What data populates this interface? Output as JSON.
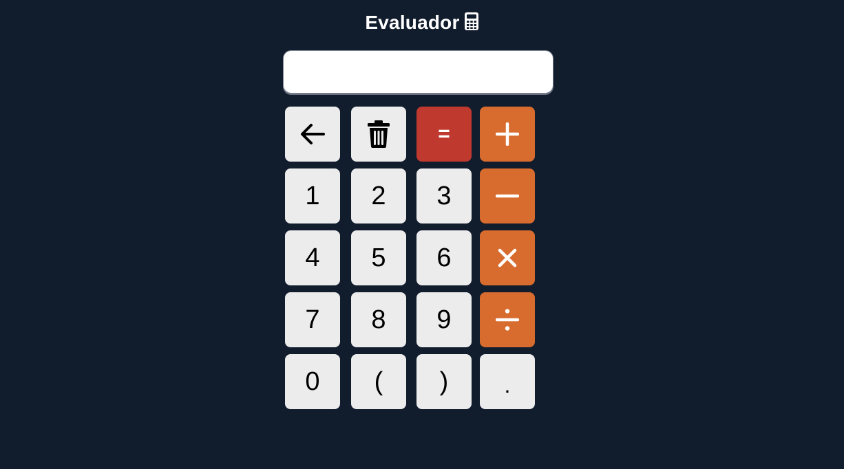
{
  "title": "Evaluador",
  "display": {
    "value": ""
  },
  "keys": {
    "backspace": "",
    "clear": "",
    "equals": "=",
    "plus": "",
    "minus": "",
    "multiply": "",
    "divide": "",
    "one": "1",
    "two": "2",
    "three": "3",
    "four": "4",
    "five": "5",
    "six": "6",
    "seven": "7",
    "eight": "8",
    "nine": "9",
    "zero": "0",
    "open_paren": "(",
    "close_paren": ")",
    "dot": "."
  },
  "icons": {
    "title": "calculator-icon",
    "backspace": "arrow-left-icon",
    "clear": "trash-icon",
    "plus": "plus-icon",
    "minus": "minus-icon",
    "multiply": "times-icon",
    "divide": "divide-icon"
  },
  "colors": {
    "background": "#111c2d",
    "key": "#ececec",
    "operator": "#d86b2e",
    "equals": "#c0392f"
  }
}
